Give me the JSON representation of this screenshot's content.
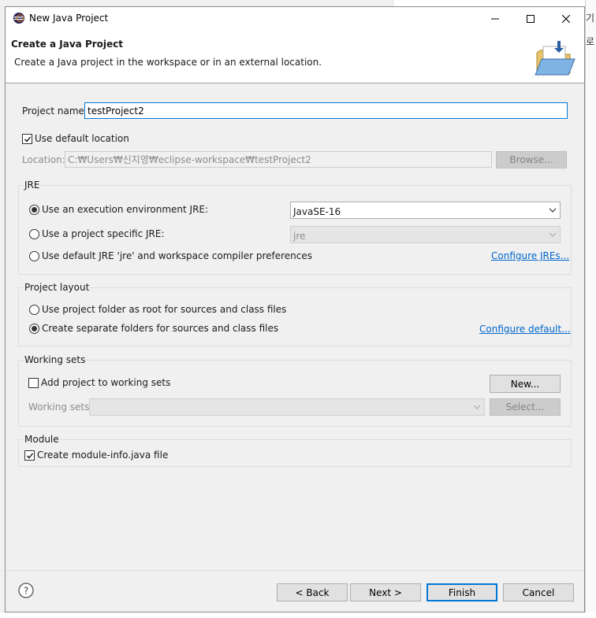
{
  "background": {
    "chars": [
      "기",
      "로"
    ]
  },
  "window": {
    "title": "New Java Project",
    "icons": {
      "app": "eclipse-icon",
      "minimize": "minimize-icon",
      "maximize": "maximize-icon",
      "close": "close-icon"
    }
  },
  "banner": {
    "title": "Create a Java Project",
    "description": "Create a Java project in the workspace or in an external location.",
    "icon": "folder-wizard-icon"
  },
  "project": {
    "name_label": "Project name:",
    "name_value": "testProject2",
    "use_default_label": "Use default location",
    "use_default_checked": true,
    "location_label": "Location:",
    "location_value": "C:₩Users₩신지영₩eclipse-workspace₩testProject2",
    "browse_label": "Browse..."
  },
  "jre": {
    "title": "JRE",
    "option_env": "Use an execution environment JRE:",
    "option_specific": "Use a project specific JRE:",
    "option_default": "Use default JRE 'jre' and workspace compiler preferences",
    "env_value": "JavaSE-16",
    "specific_value": "jre",
    "configure_link": "Configure JREs..."
  },
  "layout": {
    "title": "Project layout",
    "option_root": "Use project folder as root for sources and class files",
    "option_separate": "Create separate folders for sources and class files",
    "configure_link": "Configure default..."
  },
  "working_sets": {
    "title": "Working sets",
    "add_label": "Add project to working sets",
    "new_button": "New...",
    "sets_label": "Working sets:",
    "select_button": "Select..."
  },
  "module": {
    "title": "Module",
    "create_label": "Create module-info.java file"
  },
  "footer": {
    "help_icon": "help-icon",
    "back": "< Back",
    "next": "Next >",
    "finish": "Finish",
    "cancel": "Cancel"
  },
  "colors": {
    "accent": "#0078d7",
    "link": "#0066cc",
    "dialog_bg": "#f0f0f0"
  }
}
